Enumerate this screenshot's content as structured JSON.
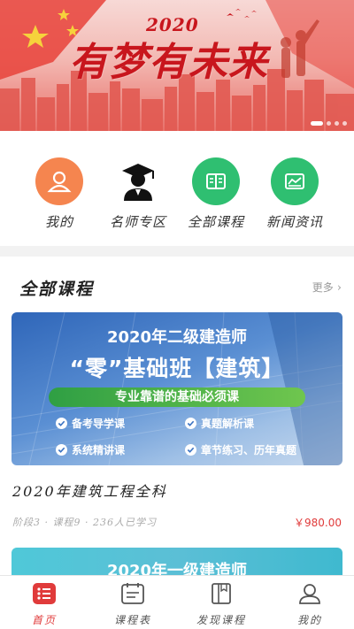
{
  "banner": {
    "year": "2020",
    "slogan": "有梦有未来",
    "dots_count": 4,
    "active_dot": 0
  },
  "quick_menu": [
    {
      "label": "我的",
      "icon": "user-icon",
      "color": "#f5854f"
    },
    {
      "label": "名师专区",
      "icon": "graduate-teacher-icon",
      "color": "#222222"
    },
    {
      "label": "全部课程",
      "icon": "book-icon",
      "color": "#2fbf71"
    },
    {
      "label": "新闻资讯",
      "icon": "news-icon",
      "color": "#2fbf71"
    }
  ],
  "courses_section": {
    "title": "全部课程",
    "more_label": "更多",
    "courses": [
      {
        "banner_line1": "2020年二级建造师",
        "banner_line2": "“零”基础班【建筑】",
        "banner_band": "专业靠谱的基础必须课",
        "features": [
          "备考导学课",
          "真题解析课",
          "系统精讲课",
          "章节练习、历年真题"
        ],
        "title": "2020年建筑工程全科",
        "meta": "阶段3 · 课程9 · 236人已学习",
        "price": "￥980.00"
      },
      {
        "banner_line1": "2020年一级建造师"
      }
    ]
  },
  "tabbar": [
    {
      "label": "首页",
      "icon": "home-list-icon",
      "active": true
    },
    {
      "label": "课程表",
      "icon": "schedule-icon",
      "active": false
    },
    {
      "label": "发现课程",
      "icon": "discover-book-icon",
      "active": false
    },
    {
      "label": "我的",
      "icon": "profile-icon",
      "active": false
    }
  ],
  "colors": {
    "accent": "#e03b3b",
    "green": "#2fbf71",
    "orange": "#f5854f"
  }
}
